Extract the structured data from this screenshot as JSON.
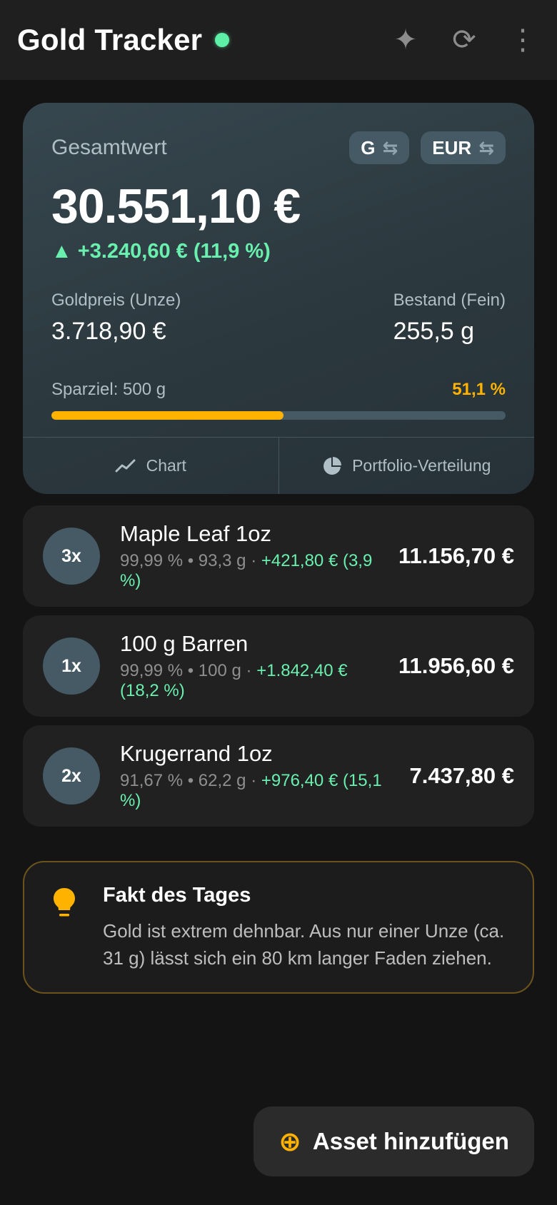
{
  "header": {
    "title": "Gold Tracker",
    "status_color": "#5ef0a6",
    "icons": {
      "theme": "✦",
      "refresh": "⟳",
      "menu": "⋮"
    }
  },
  "summary": {
    "label": "Gesamtwert",
    "unit_chip": "G",
    "currency_chip": "EUR",
    "swap_glyph": "⇆",
    "total": "30.551,10 €",
    "change": "▲ +3.240,60 € (11,9 %)",
    "gold_price_label": "Goldpreis (Unze)",
    "gold_price_value": "3.718,90 €",
    "holdings_label": "Bestand (Fein)",
    "holdings_value": "255,5 g",
    "goal_label": "Sparziel: 500 g",
    "goal_percent": "51,1 %",
    "goal_progress": 0.511,
    "actions": {
      "chart": "Chart",
      "distribution": "Portfolio-Verteilung"
    }
  },
  "assets": [
    {
      "qty": "3x",
      "name": "Maple Leaf 1oz",
      "purity": "99,99 % • 93,3 g",
      "sep": " · ",
      "gain": "+421,80 € (3,9 %)",
      "value": "11.156,70 €"
    },
    {
      "qty": "1x",
      "name": "100 g Barren",
      "purity": "99,99 % • 100 g",
      "sep": " · ",
      "gain": "+1.842,40 € (18,2 %)",
      "value": "11.956,60 €"
    },
    {
      "qty": "2x",
      "name": "Krugerrand 1oz",
      "purity": "91,67 % • 62,2 g",
      "sep": " · ",
      "gain": "+976,40 € (15,1 %)",
      "value": "7.437,80 €"
    }
  ],
  "fact": {
    "title": "Fakt des Tages",
    "text": "Gold ist extrem dehnbar. Aus nur einer Unze (ca. 31 g) lässt sich ein 80 km langer Faden ziehen.",
    "icon": "lightbulb-icon"
  },
  "fab": {
    "icon": "⊕",
    "label": "Asset hinzufügen"
  },
  "colors": {
    "accent": "#ffb300",
    "gain": "#69f0ae",
    "card": "#2f3e45"
  }
}
